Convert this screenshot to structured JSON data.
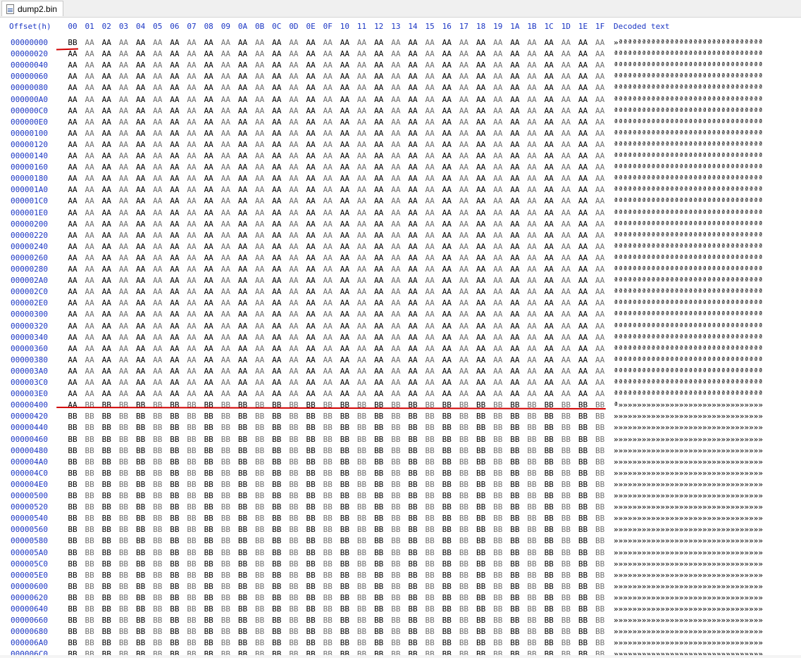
{
  "tab": {
    "title": "dump2.bin",
    "icon": "binary-file-icon"
  },
  "header": {
    "offset_label": "Offset(h)",
    "columns": [
      "00",
      "01",
      "02",
      "03",
      "04",
      "05",
      "06",
      "07",
      "08",
      "09",
      "0A",
      "0B",
      "0C",
      "0D",
      "0E",
      "0F",
      "10",
      "11",
      "12",
      "13",
      "14",
      "15",
      "16",
      "17",
      "18",
      "19",
      "1A",
      "1B",
      "1C",
      "1D",
      "1E",
      "1F"
    ],
    "decoded_label": "Decoded text"
  },
  "rows": [
    {
      "offset": "00000000",
      "fill": "AA",
      "first": "BB",
      "text": "»ªªªªªªªªªªªªªªªªªªªªªªªªªªªªªªª"
    },
    {
      "offset": "00000020",
      "fill": "AA",
      "text": "ªªªªªªªªªªªªªªªªªªªªªªªªªªªªªªªª"
    },
    {
      "offset": "00000040",
      "fill": "AA",
      "text": "ªªªªªªªªªªªªªªªªªªªªªªªªªªªªªªªª"
    },
    {
      "offset": "00000060",
      "fill": "AA",
      "text": "ªªªªªªªªªªªªªªªªªªªªªªªªªªªªªªªª"
    },
    {
      "offset": "00000080",
      "fill": "AA",
      "text": "ªªªªªªªªªªªªªªªªªªªªªªªªªªªªªªªª"
    },
    {
      "offset": "000000A0",
      "fill": "AA",
      "text": "ªªªªªªªªªªªªªªªªªªªªªªªªªªªªªªªª"
    },
    {
      "offset": "000000C0",
      "fill": "AA",
      "text": "ªªªªªªªªªªªªªªªªªªªªªªªªªªªªªªªª"
    },
    {
      "offset": "000000E0",
      "fill": "AA",
      "text": "ªªªªªªªªªªªªªªªªªªªªªªªªªªªªªªªª"
    },
    {
      "offset": "00000100",
      "fill": "AA",
      "text": "ªªªªªªªªªªªªªªªªªªªªªªªªªªªªªªªª"
    },
    {
      "offset": "00000120",
      "fill": "AA",
      "text": "ªªªªªªªªªªªªªªªªªªªªªªªªªªªªªªªª"
    },
    {
      "offset": "00000140",
      "fill": "AA",
      "text": "ªªªªªªªªªªªªªªªªªªªªªªªªªªªªªªªª"
    },
    {
      "offset": "00000160",
      "fill": "AA",
      "text": "ªªªªªªªªªªªªªªªªªªªªªªªªªªªªªªªª"
    },
    {
      "offset": "00000180",
      "fill": "AA",
      "text": "ªªªªªªªªªªªªªªªªªªªªªªªªªªªªªªªª"
    },
    {
      "offset": "000001A0",
      "fill": "AA",
      "text": "ªªªªªªªªªªªªªªªªªªªªªªªªªªªªªªªª"
    },
    {
      "offset": "000001C0",
      "fill": "AA",
      "text": "ªªªªªªªªªªªªªªªªªªªªªªªªªªªªªªªª"
    },
    {
      "offset": "000001E0",
      "fill": "AA",
      "text": "ªªªªªªªªªªªªªªªªªªªªªªªªªªªªªªªª"
    },
    {
      "offset": "00000200",
      "fill": "AA",
      "text": "ªªªªªªªªªªªªªªªªªªªªªªªªªªªªªªªª"
    },
    {
      "offset": "00000220",
      "fill": "AA",
      "text": "ªªªªªªªªªªªªªªªªªªªªªªªªªªªªªªªª"
    },
    {
      "offset": "00000240",
      "fill": "AA",
      "text": "ªªªªªªªªªªªªªªªªªªªªªªªªªªªªªªªª"
    },
    {
      "offset": "00000260",
      "fill": "AA",
      "text": "ªªªªªªªªªªªªªªªªªªªªªªªªªªªªªªªª"
    },
    {
      "offset": "00000280",
      "fill": "AA",
      "text": "ªªªªªªªªªªªªªªªªªªªªªªªªªªªªªªªª"
    },
    {
      "offset": "000002A0",
      "fill": "AA",
      "text": "ªªªªªªªªªªªªªªªªªªªªªªªªªªªªªªªª"
    },
    {
      "offset": "000002C0",
      "fill": "AA",
      "text": "ªªªªªªªªªªªªªªªªªªªªªªªªªªªªªªªª"
    },
    {
      "offset": "000002E0",
      "fill": "AA",
      "text": "ªªªªªªªªªªªªªªªªªªªªªªªªªªªªªªªª"
    },
    {
      "offset": "00000300",
      "fill": "AA",
      "text": "ªªªªªªªªªªªªªªªªªªªªªªªªªªªªªªªª"
    },
    {
      "offset": "00000320",
      "fill": "AA",
      "text": "ªªªªªªªªªªªªªªªªªªªªªªªªªªªªªªªª"
    },
    {
      "offset": "00000340",
      "fill": "AA",
      "text": "ªªªªªªªªªªªªªªªªªªªªªªªªªªªªªªªª"
    },
    {
      "offset": "00000360",
      "fill": "AA",
      "text": "ªªªªªªªªªªªªªªªªªªªªªªªªªªªªªªªª"
    },
    {
      "offset": "00000380",
      "fill": "AA",
      "text": "ªªªªªªªªªªªªªªªªªªªªªªªªªªªªªªªª"
    },
    {
      "offset": "000003A0",
      "fill": "AA",
      "text": "ªªªªªªªªªªªªªªªªªªªªªªªªªªªªªªªª"
    },
    {
      "offset": "000003C0",
      "fill": "AA",
      "text": "ªªªªªªªªªªªªªªªªªªªªªªªªªªªªªªªª"
    },
    {
      "offset": "000003E0",
      "fill": "AA",
      "text": "ªªªªªªªªªªªªªªªªªªªªªªªªªªªªªªªª"
    },
    {
      "offset": "00000400",
      "fill": "BB",
      "first": "AA",
      "text": "ª»»»»»»»»»»»»»»»»»»»»»»»»»»»»»»»"
    },
    {
      "offset": "00000420",
      "fill": "BB",
      "text": "»»»»»»»»»»»»»»»»»»»»»»»»»»»»»»»»"
    },
    {
      "offset": "00000440",
      "fill": "BB",
      "text": "»»»»»»»»»»»»»»»»»»»»»»»»»»»»»»»»"
    },
    {
      "offset": "00000460",
      "fill": "BB",
      "text": "»»»»»»»»»»»»»»»»»»»»»»»»»»»»»»»»"
    },
    {
      "offset": "00000480",
      "fill": "BB",
      "text": "»»»»»»»»»»»»»»»»»»»»»»»»»»»»»»»»"
    },
    {
      "offset": "000004A0",
      "fill": "BB",
      "text": "»»»»»»»»»»»»»»»»»»»»»»»»»»»»»»»»"
    },
    {
      "offset": "000004C0",
      "fill": "BB",
      "text": "»»»»»»»»»»»»»»»»»»»»»»»»»»»»»»»»"
    },
    {
      "offset": "000004E0",
      "fill": "BB",
      "text": "»»»»»»»»»»»»»»»»»»»»»»»»»»»»»»»»"
    },
    {
      "offset": "00000500",
      "fill": "BB",
      "text": "»»»»»»»»»»»»»»»»»»»»»»»»»»»»»»»»"
    },
    {
      "offset": "00000520",
      "fill": "BB",
      "text": "»»»»»»»»»»»»»»»»»»»»»»»»»»»»»»»»"
    },
    {
      "offset": "00000540",
      "fill": "BB",
      "text": "»»»»»»»»»»»»»»»»»»»»»»»»»»»»»»»»"
    },
    {
      "offset": "00000560",
      "fill": "BB",
      "text": "»»»»»»»»»»»»»»»»»»»»»»»»»»»»»»»»"
    },
    {
      "offset": "00000580",
      "fill": "BB",
      "text": "»»»»»»»»»»»»»»»»»»»»»»»»»»»»»»»»"
    },
    {
      "offset": "000005A0",
      "fill": "BB",
      "text": "»»»»»»»»»»»»»»»»»»»»»»»»»»»»»»»»"
    },
    {
      "offset": "000005C0",
      "fill": "BB",
      "text": "»»»»»»»»»»»»»»»»»»»»»»»»»»»»»»»»"
    },
    {
      "offset": "000005E0",
      "fill": "BB",
      "text": "»»»»»»»»»»»»»»»»»»»»»»»»»»»»»»»»"
    },
    {
      "offset": "00000600",
      "fill": "BB",
      "text": "»»»»»»»»»»»»»»»»»»»»»»»»»»»»»»»»"
    },
    {
      "offset": "00000620",
      "fill": "BB",
      "text": "»»»»»»»»»»»»»»»»»»»»»»»»»»»»»»»»"
    },
    {
      "offset": "00000640",
      "fill": "BB",
      "text": "»»»»»»»»»»»»»»»»»»»»»»»»»»»»»»»»"
    },
    {
      "offset": "00000660",
      "fill": "BB",
      "text": "»»»»»»»»»»»»»»»»»»»»»»»»»»»»»»»»"
    },
    {
      "offset": "00000680",
      "fill": "BB",
      "text": "»»»»»»»»»»»»»»»»»»»»»»»»»»»»»»»»"
    },
    {
      "offset": "000006A0",
      "fill": "BB",
      "text": "»»»»»»»»»»»»»»»»»»»»»»»»»»»»»»»»"
    },
    {
      "offset": "000006C0",
      "fill": "BB",
      "text": "»»»»»»»»»»»»»»»»»»»»»»»»»»»»»»»»"
    }
  ],
  "colors": {
    "offset_blue": "#1b36c4",
    "annotation_red": "#d10000"
  }
}
